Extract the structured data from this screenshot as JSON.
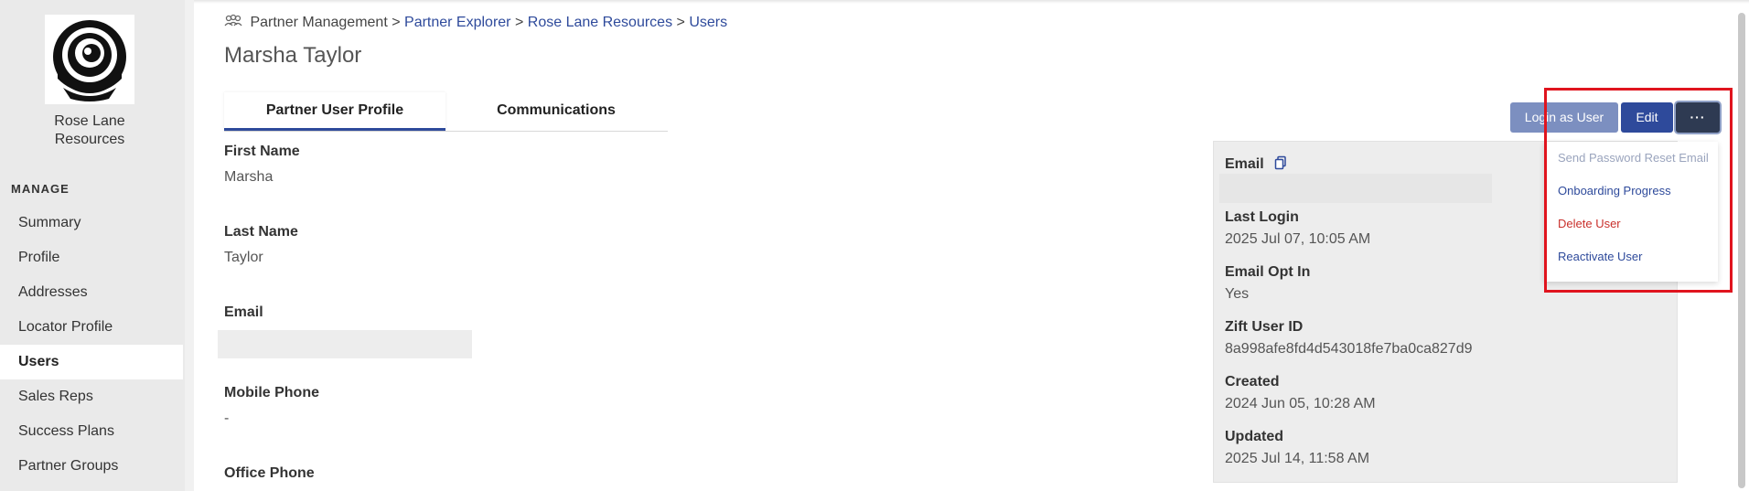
{
  "sidebar": {
    "org_name_line1": "Rose Lane",
    "org_name_line2": "Resources",
    "section_heading": "MANAGE",
    "items": [
      {
        "label": "Summary"
      },
      {
        "label": "Profile"
      },
      {
        "label": "Addresses"
      },
      {
        "label": "Locator Profile"
      },
      {
        "label": "Users"
      },
      {
        "label": "Sales Reps"
      },
      {
        "label": "Success Plans"
      },
      {
        "label": "Partner Groups"
      }
    ]
  },
  "breadcrumb": {
    "root": "Partner Management",
    "sep": ">",
    "crumb1": "Partner Explorer",
    "crumb2": "Rose Lane Resources",
    "crumb3": "Users"
  },
  "page_title": "Marsha Taylor",
  "tabs": [
    {
      "label": "Partner User Profile"
    },
    {
      "label": "Communications"
    }
  ],
  "profile": {
    "first_name_label": "First Name",
    "first_name_value": "Marsha",
    "last_name_label": "Last Name",
    "last_name_value": "Taylor",
    "email_label": "Email",
    "mobile_label": "Mobile Phone",
    "mobile_value": "-",
    "office_label": "Office Phone"
  },
  "actions": {
    "login_as_user": "Login as User",
    "edit": "Edit",
    "more": "···"
  },
  "card": {
    "email_label": "Email",
    "last_login_label": "Last Login",
    "last_login_value": "2025 Jul 07, 10:05 AM",
    "email_opt_in_label": "Email Opt In",
    "email_opt_in_value": "Yes",
    "zift_user_id_label": "Zift User ID",
    "zift_user_id_value": "8a998afe8fd4d543018fe7ba0ca827d9",
    "created_label": "Created",
    "created_value": "2024 Jun 05, 10:28 AM",
    "updated_label": "Updated",
    "updated_value": "2025 Jul 14, 11:58 AM"
  },
  "dropdown": {
    "items": [
      {
        "label": "Send Password Reset Email"
      },
      {
        "label": "Onboarding Progress"
      },
      {
        "label": "Delete User"
      },
      {
        "label": "Reactivate User"
      }
    ]
  },
  "colors": {
    "accent": "#2e4a9b",
    "danger": "#c9302c",
    "highlight": "#e0141e",
    "sidebar_bg": "#eaeaea"
  }
}
